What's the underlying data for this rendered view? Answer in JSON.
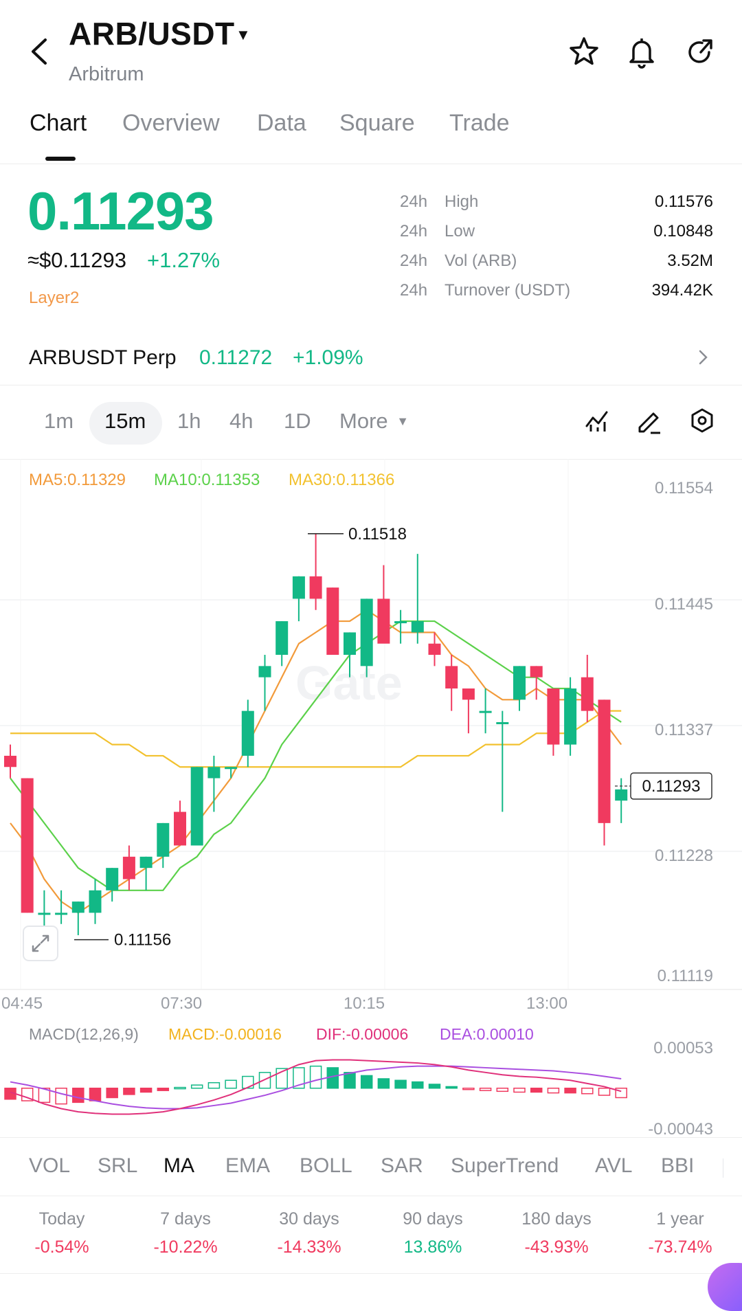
{
  "header": {
    "pair": "ARB/USDT",
    "name": "Arbitrum",
    "icons": [
      "back-icon",
      "caret-down-icon",
      "star-icon",
      "bell-icon",
      "share-icon"
    ]
  },
  "tabs": [
    {
      "label": "Chart",
      "active": true
    },
    {
      "label": "Overview",
      "active": false
    },
    {
      "label": "Data",
      "active": false
    },
    {
      "label": "Square",
      "active": false
    },
    {
      "label": "Trade",
      "active": false
    }
  ],
  "price": {
    "last": "0.11293",
    "usd": "≈$0.11293",
    "change": "+1.27%",
    "tag": "Layer2"
  },
  "stats": [
    {
      "period": "24h",
      "label": "High",
      "value": "0.11576"
    },
    {
      "period": "24h",
      "label": "Low",
      "value": "0.10848"
    },
    {
      "period": "24h",
      "label": "Vol (ARB)",
      "value": "3.52M"
    },
    {
      "period": "24h",
      "label": "Turnover (USDT)",
      "value": "394.42K"
    }
  ],
  "perp": {
    "name": "ARBUSDT Perp",
    "price": "0.11272",
    "change": "+1.09%"
  },
  "intervals": [
    {
      "label": "1m",
      "active": false
    },
    {
      "label": "15m",
      "active": true
    },
    {
      "label": "1h",
      "active": false
    },
    {
      "label": "4h",
      "active": false
    },
    {
      "label": "1D",
      "active": false
    }
  ],
  "more_label": "More",
  "chart_tools": [
    "indicator-icon",
    "draw-pencil-icon",
    "settings-hex-icon"
  ],
  "ma_legend": {
    "ma5": "MA5:0.11329",
    "ma10": "MA10:0.11353",
    "ma30": "MA30:0.11366"
  },
  "colors": {
    "up": "#12b886",
    "down": "#f03a5f",
    "ma5": "#f29a3a",
    "ma10": "#5bd14a",
    "ma30": "#f2c12e",
    "dif": "#e0307a",
    "dea": "#a94ee0",
    "macd_label": "#f2b21e"
  },
  "chart_data": {
    "type": "candlestick",
    "price_axis_labels": [
      "0.11554",
      "0.11445",
      "0.11337",
      "0.11228",
      "0.11119"
    ],
    "ylim": [
      0.11119,
      0.11554
    ],
    "time_labels": [
      "04:45",
      "07:30",
      "10:15",
      "13:00"
    ],
    "max_label": "0.11518",
    "min_label": "0.11156",
    "last_price_label": "0.11293",
    "candles": [
      {
        "o": 0.1132,
        "h": 0.1133,
        "l": 0.113,
        "c": 0.1131
      },
      {
        "o": 0.113,
        "h": 0.113,
        "l": 0.1118,
        "c": 0.1118
      },
      {
        "o": 0.1118,
        "h": 0.112,
        "l": 0.1116,
        "c": 0.1118
      },
      {
        "o": 0.1118,
        "h": 0.112,
        "l": 0.1117,
        "c": 0.1118
      },
      {
        "o": 0.1118,
        "h": 0.1119,
        "l": 0.1116,
        "c": 0.1119
      },
      {
        "o": 0.1118,
        "h": 0.1121,
        "l": 0.1117,
        "c": 0.112
      },
      {
        "o": 0.112,
        "h": 0.1122,
        "l": 0.1119,
        "c": 0.1122
      },
      {
        "o": 0.1123,
        "h": 0.1124,
        "l": 0.112,
        "c": 0.1121
      },
      {
        "o": 0.1122,
        "h": 0.1123,
        "l": 0.112,
        "c": 0.1123
      },
      {
        "o": 0.1123,
        "h": 0.1126,
        "l": 0.1122,
        "c": 0.1126
      },
      {
        "o": 0.1127,
        "h": 0.1128,
        "l": 0.1124,
        "c": 0.1124
      },
      {
        "o": 0.1124,
        "h": 0.1131,
        "l": 0.1124,
        "c": 0.1131
      },
      {
        "o": 0.113,
        "h": 0.1132,
        "l": 0.1127,
        "c": 0.1131
      },
      {
        "o": 0.1131,
        "h": 0.1131,
        "l": 0.113,
        "c": 0.1131
      },
      {
        "o": 0.1132,
        "h": 0.1137,
        "l": 0.1131,
        "c": 0.1136
      },
      {
        "o": 0.1139,
        "h": 0.1141,
        "l": 0.1136,
        "c": 0.114
      },
      {
        "o": 0.1141,
        "h": 0.1144,
        "l": 0.114,
        "c": 0.1144
      },
      {
        "o": 0.1146,
        "h": 0.1148,
        "l": 0.1144,
        "c": 0.1148
      },
      {
        "o": 0.1148,
        "h": 0.11518,
        "l": 0.1145,
        "c": 0.1146
      },
      {
        "o": 0.1147,
        "h": 0.1147,
        "l": 0.1141,
        "c": 0.1141
      },
      {
        "o": 0.1141,
        "h": 0.1143,
        "l": 0.1139,
        "c": 0.1143
      },
      {
        "o": 0.114,
        "h": 0.1146,
        "l": 0.1139,
        "c": 0.1146
      },
      {
        "o": 0.1146,
        "h": 0.1149,
        "l": 0.1143,
        "c": 0.1142
      },
      {
        "o": 0.1144,
        "h": 0.1145,
        "l": 0.1142,
        "c": 0.1144
      },
      {
        "o": 0.1143,
        "h": 0.115,
        "l": 0.1142,
        "c": 0.1144
      },
      {
        "o": 0.1142,
        "h": 0.1143,
        "l": 0.114,
        "c": 0.1141
      },
      {
        "o": 0.114,
        "h": 0.1141,
        "l": 0.1136,
        "c": 0.1138
      },
      {
        "o": 0.1138,
        "h": 0.1138,
        "l": 0.1134,
        "c": 0.1137
      },
      {
        "o": 0.1136,
        "h": 0.1138,
        "l": 0.1134,
        "c": 0.1136
      },
      {
        "o": 0.1135,
        "h": 0.1136,
        "l": 0.1127,
        "c": 0.1135
      },
      {
        "o": 0.1137,
        "h": 0.114,
        "l": 0.1136,
        "c": 0.114
      },
      {
        "o": 0.114,
        "h": 0.114,
        "l": 0.1137,
        "c": 0.1139
      },
      {
        "o": 0.1138,
        "h": 0.1138,
        "l": 0.1132,
        "c": 0.1133
      },
      {
        "o": 0.1133,
        "h": 0.1139,
        "l": 0.1132,
        "c": 0.1138
      },
      {
        "o": 0.1139,
        "h": 0.1141,
        "l": 0.1135,
        "c": 0.1136
      },
      {
        "o": 0.1137,
        "h": 0.1137,
        "l": 0.1124,
        "c": 0.1126
      },
      {
        "o": 0.1128,
        "h": 0.113,
        "l": 0.1126,
        "c": 0.1129
      }
    ],
    "ma5": [
      0.1126,
      0.1124,
      0.1121,
      0.1119,
      0.1118,
      0.1119,
      0.112,
      0.1121,
      0.1122,
      0.1123,
      0.1124,
      0.1126,
      0.1128,
      0.113,
      0.1133,
      0.1136,
      0.1139,
      0.1142,
      0.1143,
      0.1144,
      0.1144,
      0.1145,
      0.1144,
      0.1143,
      0.1143,
      0.1143,
      0.1141,
      0.114,
      0.1138,
      0.1137,
      0.1137,
      0.1138,
      0.1137,
      0.1137,
      0.1137,
      0.1135,
      0.1133
    ],
    "ma10": [
      0.113,
      0.1128,
      0.1126,
      0.1124,
      0.1122,
      0.1121,
      0.112,
      0.112,
      0.112,
      0.112,
      0.1122,
      0.1123,
      0.1125,
      0.1126,
      0.1128,
      0.113,
      0.1133,
      0.1135,
      0.1137,
      0.1139,
      0.1141,
      0.1142,
      0.1143,
      0.1144,
      0.1144,
      0.1144,
      0.1143,
      0.1142,
      0.1141,
      0.114,
      0.1139,
      0.1139,
      0.1138,
      0.1138,
      0.1137,
      0.1136,
      0.1135
    ],
    "ma30": [
      0.1134,
      0.1134,
      0.1134,
      0.1134,
      0.1134,
      0.1134,
      0.1133,
      0.1133,
      0.1132,
      0.1132,
      0.1131,
      0.1131,
      0.1131,
      0.1131,
      0.1131,
      0.1131,
      0.1131,
      0.1131,
      0.1131,
      0.1131,
      0.1131,
      0.1131,
      0.1131,
      0.1131,
      0.1132,
      0.1132,
      0.1132,
      0.1132,
      0.1133,
      0.1133,
      0.1133,
      0.1134,
      0.1134,
      0.1134,
      0.1135,
      0.1136,
      0.1136
    ],
    "macd": {
      "axis_labels": [
        "0.00053",
        "-0.00043"
      ],
      "legend_prefix": "MACD(12,26,9)",
      "macd_label": "MACD:-0.00016",
      "dif_label": "DIF:-0.00006",
      "dea_label": "DEA:0.00010",
      "histogram": [
        -0.00014,
        -0.00016,
        -0.00018,
        -0.0002,
        -0.00018,
        -0.00016,
        -0.00012,
        -8e-05,
        -5e-05,
        -3e-05,
        1e-05,
        4e-05,
        7e-05,
        0.0001,
        0.00015,
        0.0002,
        0.00025,
        0.00026,
        0.00028,
        0.00026,
        0.0002,
        0.00016,
        0.00012,
        0.0001,
        8e-05,
        5e-05,
        2e-05,
        -1e-05,
        -3e-05,
        -4e-05,
        -5e-05,
        -5e-05,
        -6e-05,
        -6e-05,
        -7e-05,
        -9e-05,
        -0.00012
      ],
      "dif": [
        -5e-05,
        -0.00012,
        -0.0002,
        -0.00026,
        -0.0003,
        -0.00032,
        -0.00033,
        -0.00033,
        -0.00032,
        -0.0003,
        -0.00026,
        -0.00021,
        -0.00015,
        -8e-05,
        1e-05,
        0.00011,
        0.00021,
        0.0003,
        0.00035,
        0.00036,
        0.00036,
        0.00035,
        0.00034,
        0.00033,
        0.00032,
        0.0003,
        0.00027,
        0.00023,
        0.0002,
        0.00017,
        0.00015,
        0.00014,
        0.00012,
        0.0001,
        6e-05,
        2e-05,
        -4e-05
      ],
      "dea": [
        8e-05,
        4e-05,
        -1e-05,
        -7e-05,
        -0.00012,
        -0.00016,
        -0.0002,
        -0.00023,
        -0.00025,
        -0.00026,
        -0.00026,
        -0.00025,
        -0.00022,
        -0.00019,
        -0.00014,
        -9e-05,
        -3e-05,
        4e-05,
        0.0001,
        0.00015,
        0.00019,
        0.00023,
        0.00025,
        0.00027,
        0.00028,
        0.00028,
        0.00028,
        0.00027,
        0.00026,
        0.00025,
        0.00024,
        0.00023,
        0.00022,
        0.0002,
        0.00018,
        0.00015,
        0.00012
      ]
    }
  },
  "indicators": [
    {
      "label": "VOL",
      "active": false
    },
    {
      "label": "SRL",
      "active": false
    },
    {
      "label": "MA",
      "active": true
    },
    {
      "label": "EMA",
      "active": false
    },
    {
      "label": "BOLL",
      "active": false
    },
    {
      "label": "SAR",
      "active": false
    },
    {
      "label": "SuperTrend",
      "active": false
    },
    {
      "label": "AVL",
      "active": false
    },
    {
      "label": "BBI",
      "active": false
    }
  ],
  "performance": [
    {
      "label": "Today",
      "value": "-0.54%",
      "up": false
    },
    {
      "label": "7 days",
      "value": "-10.22%",
      "up": false
    },
    {
      "label": "30 days",
      "value": "-14.33%",
      "up": false
    },
    {
      "label": "90 days",
      "value": "13.86%",
      "up": true
    },
    {
      "label": "180 days",
      "value": "-43.93%",
      "up": false
    },
    {
      "label": "1 year",
      "value": "-73.74%",
      "up": false
    }
  ]
}
